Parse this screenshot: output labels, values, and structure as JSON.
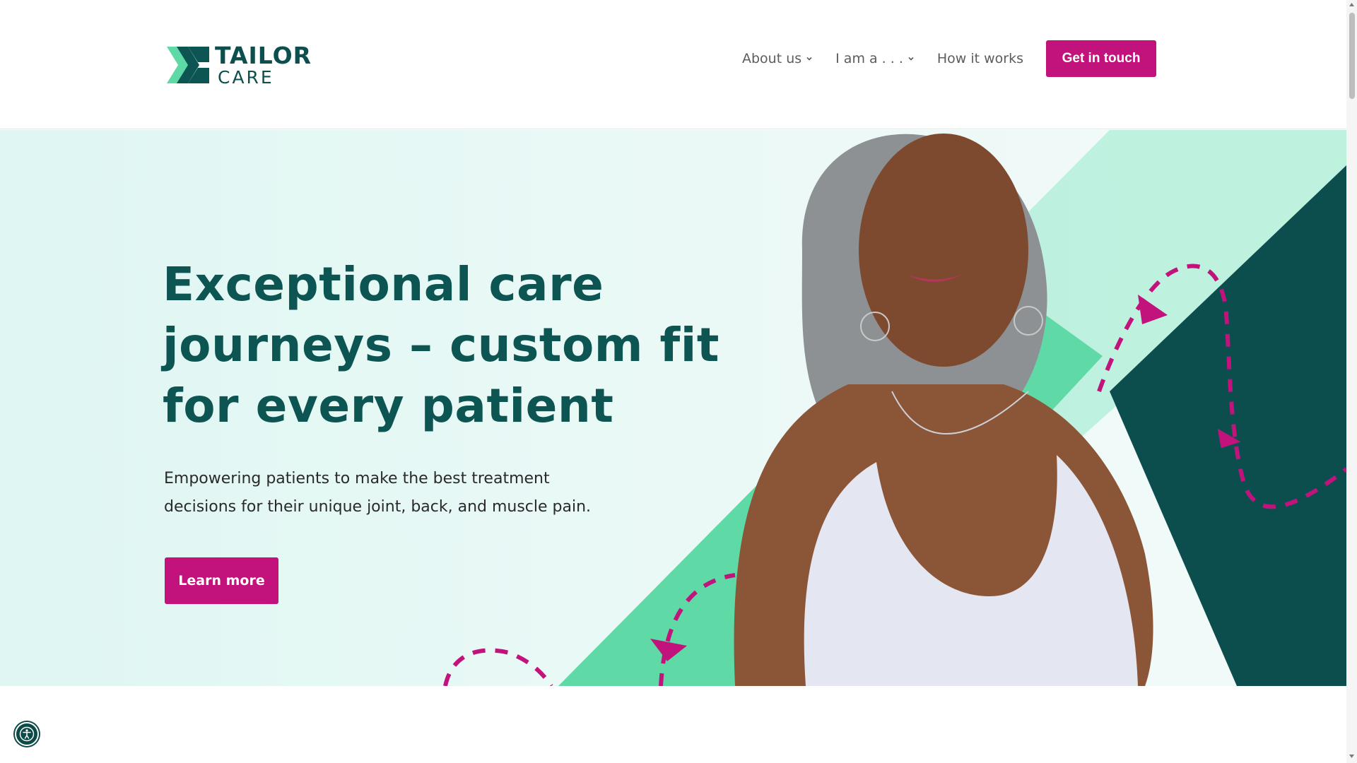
{
  "brand": {
    "word_1": "TAILOR",
    "word_2": "CARE",
    "colors": {
      "teal_dark": "#0c5553",
      "magenta": "#c2127c",
      "mint": "#5fd9a5",
      "mint_light": "#a9ecd4"
    }
  },
  "nav": {
    "items": [
      {
        "label": "About us",
        "has_dropdown": true,
        "icon": "chevron-down-icon"
      },
      {
        "label": "I am a . . .",
        "has_dropdown": true,
        "icon": "chevron-down-icon"
      },
      {
        "label": "How it works",
        "has_dropdown": false
      }
    ],
    "cta_label": "Get in touch"
  },
  "hero": {
    "title": "Exceptional care journeys – custom fit for every patient",
    "subtitle": "Empowering patients to make the best treatment decisions for their unique joint, back, and muscle pain.",
    "cta_label": "Learn more"
  },
  "accessibility": {
    "icon": "accessibility-icon"
  },
  "scrollbar": {
    "up_icon": "scroll-up-arrow-icon",
    "down_icon": "scroll-down-arrow-icon"
  }
}
